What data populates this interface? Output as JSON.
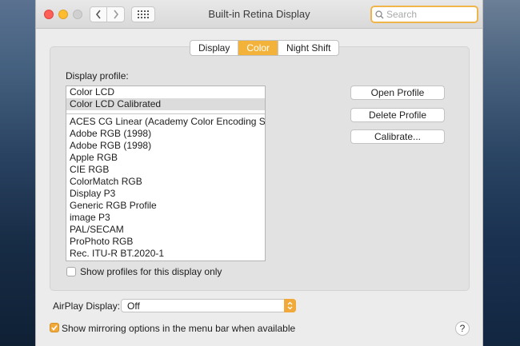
{
  "window": {
    "title": "Built-in Retina Display"
  },
  "search": {
    "placeholder": "Search"
  },
  "tabs": [
    {
      "label": "Display",
      "active": false
    },
    {
      "label": "Color",
      "active": true
    },
    {
      "label": "Night Shift",
      "active": false
    }
  ],
  "color_panel": {
    "profile_label": "Display profile:",
    "profiles_top": [
      {
        "label": "Color LCD",
        "selected": false
      },
      {
        "label": "Color LCD Calibrated",
        "selected": true
      }
    ],
    "profiles_other": [
      "ACES CG Linear (Academy Color Encoding Sy...",
      "Adobe RGB (1998)",
      "Adobe RGB (1998)",
      "Apple RGB",
      "CIE RGB",
      "ColorMatch RGB",
      "Display P3",
      "Generic RGB Profile",
      "image P3",
      "PAL/SECAM",
      "ProPhoto RGB",
      "Rec. ITU-R BT.2020-1"
    ],
    "buttons": {
      "open": "Open Profile",
      "delete": "Delete Profile",
      "calibrate": "Calibrate..."
    },
    "show_profiles_label": "Show profiles for this display only",
    "show_profiles_checked": false
  },
  "airplay": {
    "label": "AirPlay Display:",
    "value": "Off"
  },
  "mirroring": {
    "label": "Show mirroring options in the menu bar when available",
    "checked": true
  },
  "help": {
    "label": "?"
  },
  "colors": {
    "accent": "#f3b239",
    "search_focus": "#f0b54a"
  }
}
